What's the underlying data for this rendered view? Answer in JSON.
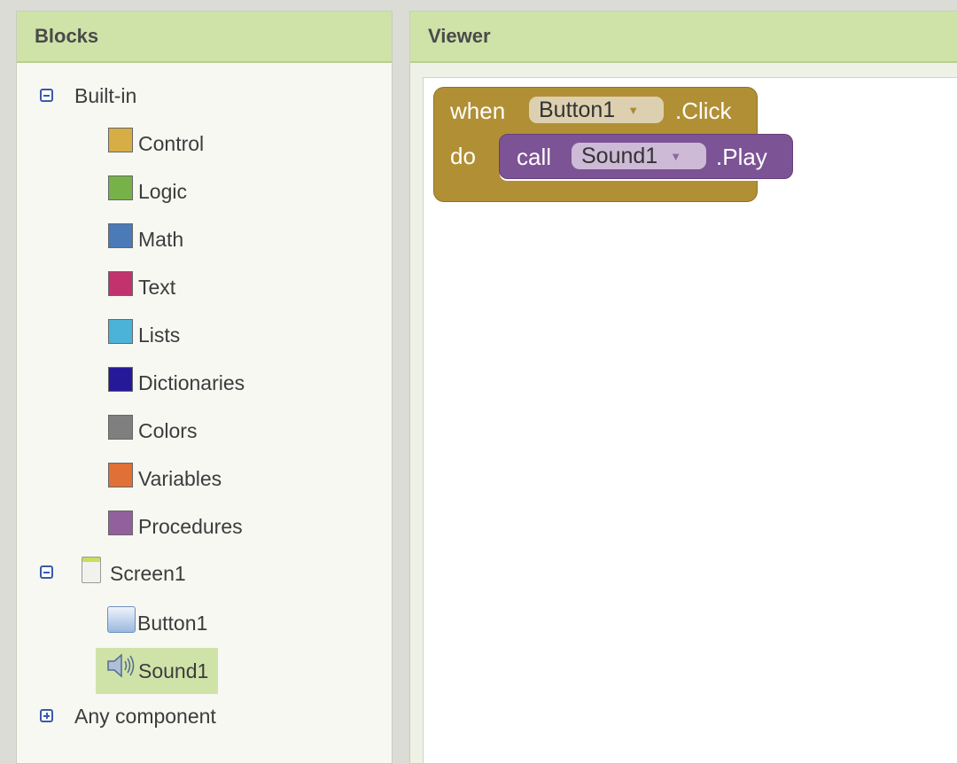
{
  "blocks_panel": {
    "title": "Blocks",
    "builtin": {
      "label": "Built-in",
      "items": [
        {
          "label": "Control",
          "color": "#d6ae45"
        },
        {
          "label": "Logic",
          "color": "#77b248"
        },
        {
          "label": "Math",
          "color": "#4a7ab8"
        },
        {
          "label": "Text",
          "color": "#c2336e"
        },
        {
          "label": "Lists",
          "color": "#4bb2d8"
        },
        {
          "label": "Dictionaries",
          "color": "#25199a"
        },
        {
          "label": "Colors",
          "color": "#7f7f7f"
        },
        {
          "label": "Variables",
          "color": "#e07035"
        },
        {
          "label": "Procedures",
          "color": "#93609e"
        }
      ]
    },
    "screen": {
      "label": "Screen1",
      "components": [
        {
          "label": "Button1",
          "icon": "button-icon"
        },
        {
          "label": "Sound1",
          "icon": "speaker-icon",
          "selected": true
        }
      ]
    },
    "any_component": {
      "label": "Any component"
    }
  },
  "viewer": {
    "title": "Viewer",
    "event_block": {
      "when": "when",
      "component": "Button1",
      "event": ".Click",
      "do": "do",
      "color": "#b18f35"
    },
    "call_block": {
      "call": "call",
      "component": "Sound1",
      "method": ".Play",
      "color": "#7c5394"
    }
  }
}
